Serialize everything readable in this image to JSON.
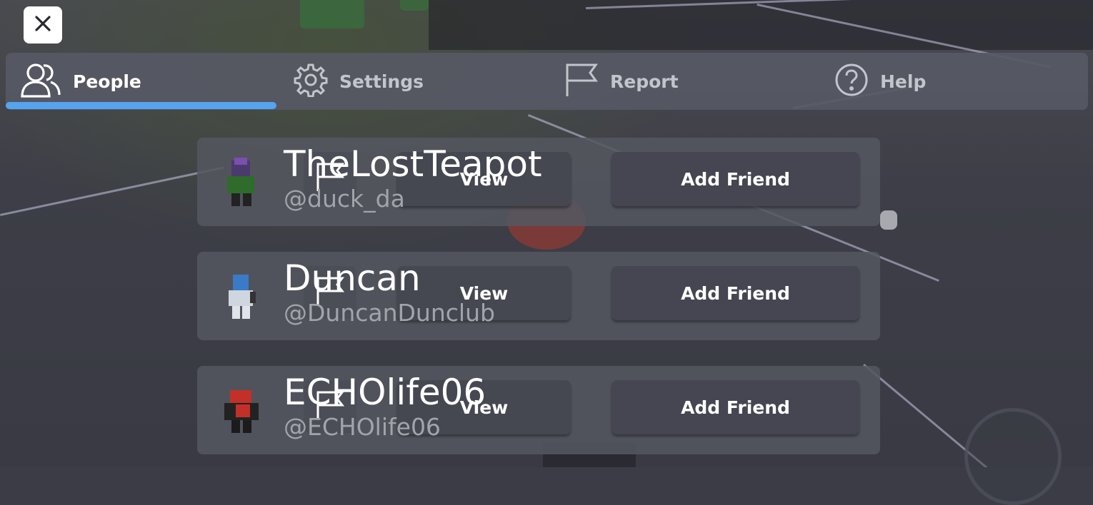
{
  "header": {
    "close_icon": "close-icon"
  },
  "tabs": [
    {
      "label": "People",
      "icon": "people-icon",
      "active": true
    },
    {
      "label": "Settings",
      "icon": "gear-icon",
      "active": false
    },
    {
      "label": "Report",
      "icon": "flag-icon",
      "active": false
    },
    {
      "label": "Help",
      "icon": "help-icon",
      "active": false
    }
  ],
  "accent_color": "#56a3f0",
  "players": [
    {
      "display_name": "TheLostTeapot",
      "username": "@duck_da",
      "view_label": "View",
      "add_friend_label": "Add Friend"
    },
    {
      "display_name": "Duncan",
      "username": "@DuncanDunclub",
      "view_label": "View",
      "add_friend_label": "Add Friend"
    },
    {
      "display_name": "ECHOlife06",
      "username": "@ECHOlife06",
      "view_label": "View",
      "add_friend_label": "Add Friend"
    }
  ]
}
